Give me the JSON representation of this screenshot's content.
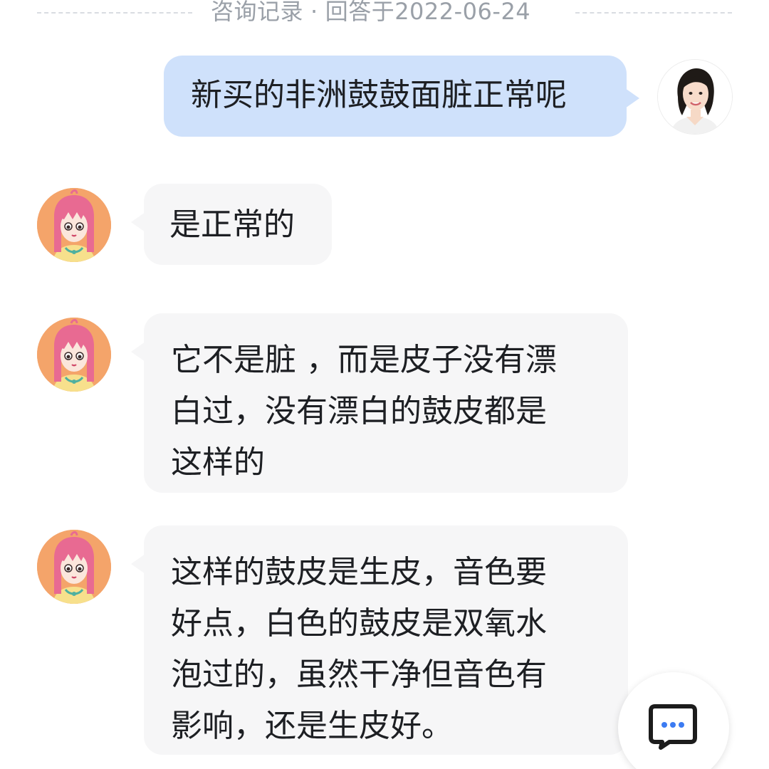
{
  "header": {
    "title": "咨询记录",
    "separator": "·",
    "answered": "回答于2022-06-24"
  },
  "messages": {
    "user_question": "新买的非洲鼓鼓面脏正常呢",
    "reply_1": "是正常的",
    "reply_2_lines": [
      "它不是脏 ，而是皮子没有漂",
      "白过，没有漂白的鼓皮都是",
      "这样的"
    ],
    "reply_3_lines": [
      "这样的鼓皮是生皮，音色要",
      "好点，白色的鼓皮是双氧水",
      "泡过的，虽然干净但音色有",
      "影响，还是生皮好。"
    ]
  },
  "colors": {
    "user_bubble": "#cfe1fb",
    "expert_bubble": "#f6f6f7",
    "expert_avatar_bg": "#f4a46a",
    "header_text": "#9aa0a8",
    "fab_icon_dots": "#3c7bf2"
  },
  "icons": {
    "user_avatar": "user-avatar-photo",
    "expert_avatar": "cartoon-girl-avatar",
    "fab": "chat-bubble-icon"
  }
}
